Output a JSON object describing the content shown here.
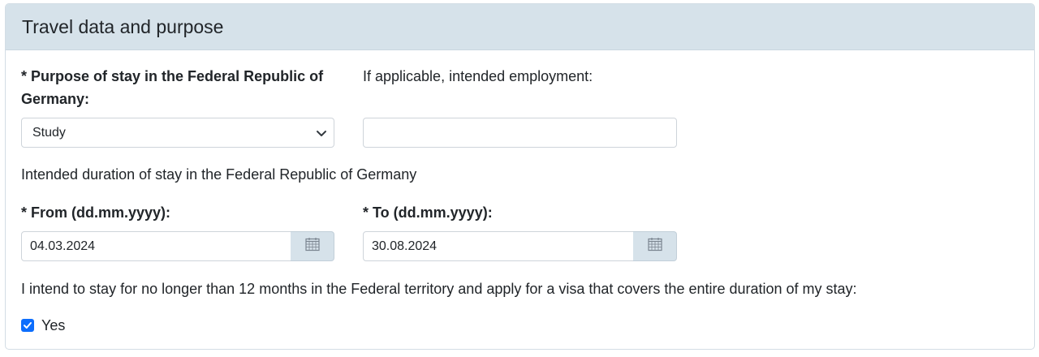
{
  "section": {
    "title": "Travel data and purpose"
  },
  "purpose": {
    "label": "* Purpose of stay in the Federal Republic of Germany:",
    "selected": "Study"
  },
  "employment": {
    "label": "If applicable, intended employment:",
    "value": ""
  },
  "duration": {
    "heading": "Intended duration of stay in the Federal Republic of Germany",
    "from_label": "* From (dd.mm.yyyy):",
    "from_value": "04.03.2024",
    "to_label": "* To (dd.mm.yyyy):",
    "to_value": "30.08.2024"
  },
  "declaration": {
    "text": "I intend to stay for no longer than 12 months in the Federal territory and apply for a visa that covers the entire duration of my stay:",
    "checkbox_label": "Yes",
    "checked": true
  },
  "icons": {
    "calendar": "calendar-icon",
    "chevron": "chevron-down-icon",
    "check": "check-icon"
  },
  "colors": {
    "header_bg": "#d6e2ea",
    "checkbox": "#0d6efd"
  }
}
